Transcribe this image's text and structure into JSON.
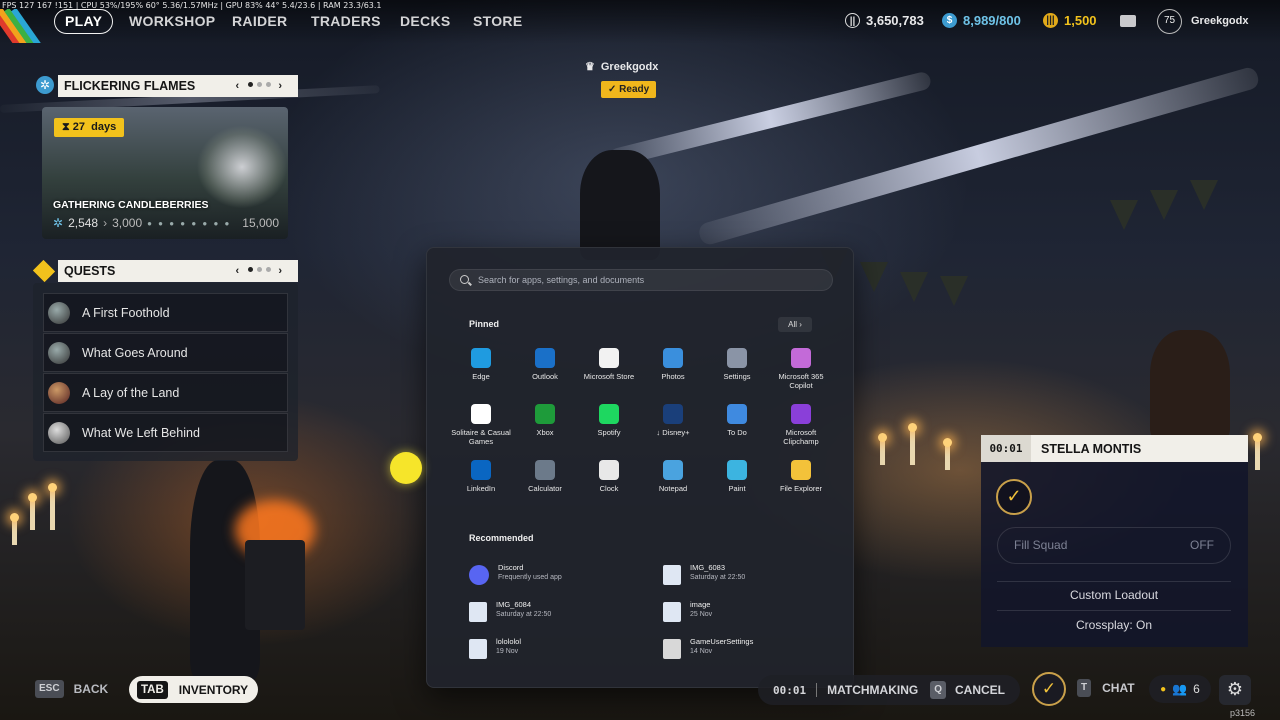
{
  "perf_overlay": "FPS 127 167 !151 | CPU 53%/195% 60° 5.36/1.57MHz | GPU 83% 44° 5.4/23.6 | RAM 23.3/63.1",
  "nav": {
    "play": "PLAY",
    "workshop": "WORKSHOP",
    "raider": "RAIDER",
    "traders": "TRADERS",
    "decks": "DECKS",
    "store": "STORE"
  },
  "stats": {
    "coins": "3,650,783",
    "raider_tokens": "8,989/800",
    "credits": "1,500"
  },
  "player": {
    "level": "75",
    "name": "Greekgodx"
  },
  "event": {
    "header": "FLICKERING FLAMES",
    "days_number": "27",
    "days_unit": "days",
    "title": "GATHERING CANDLEBERRIES",
    "progress_current": "2,548",
    "progress_next": "3,000",
    "progress_max": "15,000"
  },
  "quests": {
    "header": "QUESTS",
    "items": [
      {
        "label": "A First Foothold"
      },
      {
        "label": "What Goes Around"
      },
      {
        "label": "A Lay of the Land"
      },
      {
        "label": "What We Left Behind"
      }
    ]
  },
  "ready": {
    "name": "Greekgodx",
    "status": "Ready"
  },
  "start_menu": {
    "search_placeholder": "Search for apps, settings, and documents",
    "pinned_label": "Pinned",
    "all_label": "All",
    "recommended_label": "Recommended",
    "pinned": [
      {
        "label": "Edge",
        "icon": "edge-icon",
        "color": "#1f9be0"
      },
      {
        "label": "Outlook",
        "icon": "outlook-icon",
        "color": "#1a70c8"
      },
      {
        "label": "Microsoft Store",
        "icon": "store-icon",
        "color": "#f2f2f2"
      },
      {
        "label": "Photos",
        "icon": "photos-icon",
        "color": "#3a8fdd"
      },
      {
        "label": "Settings",
        "icon": "settings-icon",
        "color": "#8a94a6"
      },
      {
        "label": "Microsoft 365 Copilot",
        "icon": "copilot-icon",
        "color": "#c36ad8"
      },
      {
        "label": "Solitaire & Casual Games",
        "icon": "solitaire-icon",
        "color": "#ffffff"
      },
      {
        "label": "Xbox",
        "icon": "xbox-icon",
        "color": "#1e9b3a"
      },
      {
        "label": "Spotify",
        "icon": "spotify-icon",
        "color": "#1ed760"
      },
      {
        "label": "↓ Disney+",
        "icon": "disney-icon",
        "color": "#1a3f7a"
      },
      {
        "label": "To Do",
        "icon": "todo-icon",
        "color": "#3f8ae0"
      },
      {
        "label": "Microsoft Clipchamp",
        "icon": "clipchamp-icon",
        "color": "#8a3fd9"
      },
      {
        "label": "LinkedIn",
        "icon": "linkedin-icon",
        "color": "#0a66c2"
      },
      {
        "label": "Calculator",
        "icon": "calculator-icon",
        "color": "#6c7a8a"
      },
      {
        "label": "Clock",
        "icon": "clock-icon",
        "color": "#e8e8e8"
      },
      {
        "label": "Notepad",
        "icon": "notepad-icon",
        "color": "#4aa3df"
      },
      {
        "label": "Paint",
        "icon": "paint-icon",
        "color": "#3cb4e0"
      },
      {
        "label": "File Explorer",
        "icon": "folder-icon",
        "color": "#f3c23a"
      }
    ],
    "recommended": [
      {
        "name": "Discord",
        "sub": "Frequently used app",
        "icon": "discord-icon",
        "color": "#5865f2"
      },
      {
        "name": "IMG_6083",
        "sub": "Saturday at 22:50",
        "icon": "image-file-icon",
        "color": "#dfe7f3"
      },
      {
        "name": "IMG_6084",
        "sub": "Saturday at 22:50",
        "icon": "image-file-icon",
        "color": "#dfe7f3"
      },
      {
        "name": "image",
        "sub": "25 Nov",
        "icon": "image-file-icon",
        "color": "#dfe7f3"
      },
      {
        "name": "lolololol",
        "sub": "19 Nov",
        "icon": "image-file-icon",
        "color": "#dfe7f3"
      },
      {
        "name": "GameUserSettings",
        "sub": "14 Nov",
        "icon": "settings-file-icon",
        "color": "#d8d8d8"
      }
    ]
  },
  "squad": {
    "timer": "00:01",
    "map": "STELLA MONTIS",
    "fill_label": "Fill Squad",
    "fill_value": "OFF",
    "custom_loadout": "Custom Loadout",
    "crossplay": "Crossplay: On"
  },
  "bottom": {
    "back_key": "ESC",
    "back_label": "BACK",
    "inventory_key": "TAB",
    "inventory_label": "INVENTORY",
    "mm_timer": "00:01",
    "mm_label": "MATCHMAKING",
    "cancel_key": "Q",
    "cancel_label": "CANCEL",
    "chat_key": "T",
    "chat_label": "CHAT",
    "party_count": "6"
  },
  "build_id": "p3156",
  "colors": {
    "accent_yellow": "#f2c21c",
    "panel_light": "#f1efe9",
    "start_bg": "#20232c"
  }
}
